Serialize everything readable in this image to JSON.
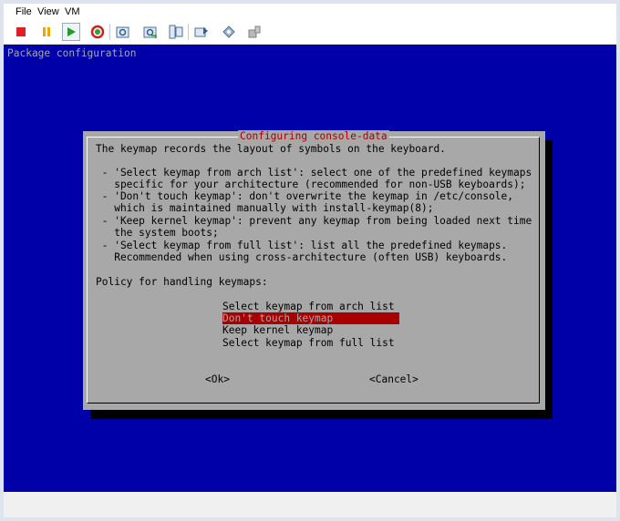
{
  "menu": {
    "file": "File",
    "view": "View",
    "vm": "VM"
  },
  "toolbar": {
    "icons": [
      "stop-icon",
      "pause-icon",
      "play-icon",
      "reset-icon",
      "snapshot-icon",
      "revert-snapshot-icon",
      "manage-snapshots-icon",
      "send-ctrl-alt-del-icon",
      "vm-settings-icon",
      "install-tools-icon"
    ],
    "colors": {
      "stop": "#e02020",
      "pause": "#f0a800",
      "play": "#20a020"
    }
  },
  "terminal": {
    "header": "Package configuration",
    "background": "#0000a8",
    "dialog": {
      "title": "Configuring console-data",
      "intro": "The keymap records the layout of symbols on the keyboard.",
      "lines": [
        " - 'Select keymap from arch list': select one of the predefined keymaps",
        "   specific for your architecture (recommended for non-USB keyboards);",
        " - 'Don't touch keymap': don't overwrite the keymap in /etc/console,",
        "   which is maintained manually with install-keymap(8);",
        " - 'Keep kernel keymap': prevent any keymap from being loaded next time",
        "   the system boots;",
        " - 'Select keymap from full list': list all the predefined keymaps.",
        "   Recommended when using cross-architecture (often USB) keyboards."
      ],
      "prompt": "Policy for handling keymaps:",
      "options": [
        "Select keymap from arch list",
        "Don't touch keymap",
        "Keep kernel keymap",
        "Select keymap from full list"
      ],
      "selected_index": 1,
      "ok": "<Ok>",
      "cancel": "<Cancel>"
    }
  }
}
